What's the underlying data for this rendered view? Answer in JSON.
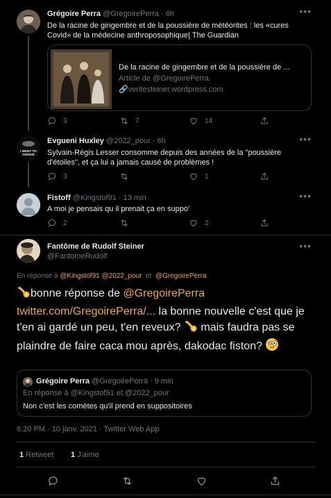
{
  "tweets": [
    {
      "name": "Grégoire Perra",
      "handle": "@GregoirePerra · 6h",
      "text": "De la racine de gingembre et de la poussière de météorites : les «cures Covid» de la médecine anthroposophique| The Guardian",
      "card": {
        "title": "De la racine de gingembre et de la poussière de ...",
        "subtitle": "Article de @GregoirePerra.",
        "domain": "veritesteiner.wordpress.com"
      },
      "counts": {
        "reply": "3",
        "retweet": "7",
        "like": "14"
      }
    },
    {
      "name": "Evgueni Huxley",
      "handle": "@2022_pour · 6h",
      "avatar_text": "I WANT TO CROIVE",
      "text": "Sylvain-Régis Lesser consomme depuis des années de la \"poussière d'étoiles\", et ça lui a jamais causé de problèmes !",
      "counts": {
        "reply": "3",
        "retweet": "",
        "like": "1"
      }
    },
    {
      "name": "Fistoff",
      "handle": "@Kingstof91 · 13 min",
      "text": "A moi je pensais qu il prenait ça en suppo'",
      "counts": {
        "reply": "2",
        "retweet": "",
        "like": "2"
      }
    }
  ],
  "main": {
    "name": "Fantôme de Rudolf Steiner",
    "handle": "@FantomeRudolf",
    "reply_prefix": "En réponse à",
    "reply_to_1": "@Kingstof91",
    "reply_to_2": "@2022_pour",
    "reply_and": "et",
    "reply_to_3": "@GregoirePerra",
    "text_1": "bonne réponse de ",
    "text_mention": "@GregoirePerra",
    "text_link": "twitter.com/GregoirePerra/...",
    "text_2": " la bonne nouvelle c'est que je t'en ai gardé un peu, t'en reveux? ",
    "text_3": " mais faudra pas se plaindre de faire caca mou après, dakodac fiston? ",
    "quote": {
      "name": "Grégoire Perra",
      "handle": "@GregoirePerra · 9 min",
      "reply": "En réponse à @Kingstof91  et  @2022_pour",
      "text": "Non c'est les comètes qu'il prend en suppositoires"
    },
    "timestamp": "6:20 PM · 10 janv. 2021 · Twitter Web App",
    "retweets_count": "1",
    "retweets_label": "Retweet",
    "likes_count": "1",
    "likes_label": "J'aime"
  },
  "colors": {
    "accent": "#f4a73b",
    "background": "#000000",
    "muted": "#71767b"
  },
  "icons": [
    "reply-icon",
    "retweet-icon",
    "like-icon",
    "share-icon",
    "more-icon",
    "link-icon",
    "comet-emoji",
    "face-emoji"
  ]
}
